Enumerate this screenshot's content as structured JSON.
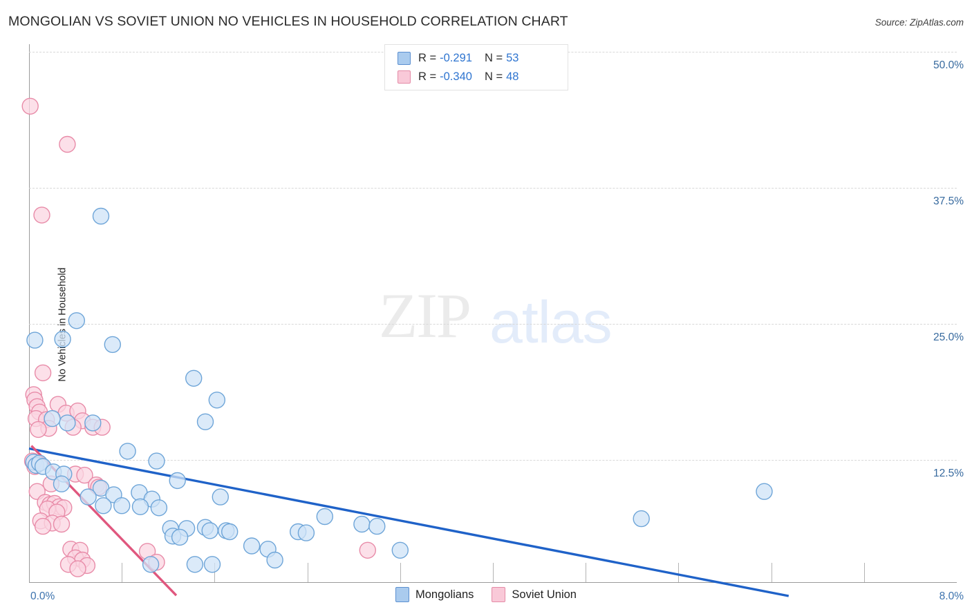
{
  "header": {
    "title": "MONGOLIAN VS SOVIET UNION NO VEHICLES IN HOUSEHOLD CORRELATION CHART",
    "source": "Source: ZipAtlas.com"
  },
  "watermark": {
    "part1": "ZIP",
    "part2": "atlas"
  },
  "stats": {
    "rows": [
      {
        "series": "Mongolians",
        "r_label": "R =",
        "r_value": "-0.291",
        "n_label": "N =",
        "n_value": "53",
        "color": "#aacbee"
      },
      {
        "series": "Soviet Union",
        "r_label": "R =",
        "r_value": "-0.340",
        "n_label": "N =",
        "n_value": "48",
        "color": "#f9c9d8"
      }
    ]
  },
  "legend": {
    "items": [
      {
        "label": "Mongolians",
        "color": "#aacbee"
      },
      {
        "label": "Soviet Union",
        "color": "#f9c9d8"
      }
    ]
  },
  "chart_data": {
    "type": "scatter",
    "title": "MONGOLIAN VS SOVIET UNION NO VEHICLES IN HOUSEHOLD CORRELATION CHART",
    "xlabel": "",
    "ylabel": "No Vehicles in Household",
    "xlim": [
      0.0,
      8.0
    ],
    "ylim": [
      0.0,
      53.0
    ],
    "grid": true,
    "legend_position": "bottom-center",
    "x_ticks": [
      {
        "value": 0.0,
        "label": "0.0%"
      },
      {
        "value": 8.0,
        "label": "8.0%"
      }
    ],
    "x_minor_ticks": [
      0.8,
      1.6,
      2.4,
      3.2,
      4.0,
      4.8,
      5.6,
      6.4,
      7.2
    ],
    "y_ticks": [
      {
        "value": 50.0,
        "label": "50.0%"
      },
      {
        "value": 37.5,
        "label": "37.5%"
      },
      {
        "value": 25.0,
        "label": "25.0%"
      },
      {
        "value": 12.5,
        "label": "12.5%"
      }
    ],
    "series": [
      {
        "name": "Mongolians",
        "color": "#cfe3f7",
        "edge": "#6ea5d8",
        "r": -0.291,
        "n": 53,
        "trendline": {
          "x0": 0.0,
          "y0": 13.55,
          "x1": 6.55,
          "y1": 0.0,
          "color": "#1f62c8"
        },
        "points": [
          {
            "x": 0.62,
            "y": 34.9
          },
          {
            "x": 0.41,
            "y": 25.3
          },
          {
            "x": 0.05,
            "y": 23.5
          },
          {
            "x": 0.29,
            "y": 23.6
          },
          {
            "x": 0.72,
            "y": 23.1
          },
          {
            "x": 1.42,
            "y": 20.0
          },
          {
            "x": 1.62,
            "y": 18.0
          },
          {
            "x": 1.52,
            "y": 16.0
          },
          {
            "x": 0.33,
            "y": 15.9
          },
          {
            "x": 0.2,
            "y": 16.3
          },
          {
            "x": 0.55,
            "y": 15.9
          },
          {
            "x": 0.85,
            "y": 13.3
          },
          {
            "x": 1.1,
            "y": 12.4
          },
          {
            "x": 0.04,
            "y": 12.3
          },
          {
            "x": 0.06,
            "y": 12.0
          },
          {
            "x": 0.09,
            "y": 12.2
          },
          {
            "x": 0.12,
            "y": 11.9
          },
          {
            "x": 0.21,
            "y": 11.4
          },
          {
            "x": 0.3,
            "y": 11.2
          },
          {
            "x": 1.28,
            "y": 10.6
          },
          {
            "x": 0.28,
            "y": 10.3
          },
          {
            "x": 0.62,
            "y": 9.9
          },
          {
            "x": 0.95,
            "y": 9.5
          },
          {
            "x": 0.73,
            "y": 9.3
          },
          {
            "x": 0.51,
            "y": 9.1
          },
          {
            "x": 1.06,
            "y": 8.9
          },
          {
            "x": 1.65,
            "y": 9.1
          },
          {
            "x": 0.64,
            "y": 8.3
          },
          {
            "x": 0.8,
            "y": 8.3
          },
          {
            "x": 0.96,
            "y": 8.2
          },
          {
            "x": 1.12,
            "y": 8.1
          },
          {
            "x": 2.55,
            "y": 7.3
          },
          {
            "x": 2.87,
            "y": 6.6
          },
          {
            "x": 3.0,
            "y": 6.4
          },
          {
            "x": 1.22,
            "y": 6.2
          },
          {
            "x": 1.36,
            "y": 6.2
          },
          {
            "x": 1.52,
            "y": 6.3
          },
          {
            "x": 1.24,
            "y": 5.5
          },
          {
            "x": 1.3,
            "y": 5.4
          },
          {
            "x": 1.56,
            "y": 6.0
          },
          {
            "x": 1.7,
            "y": 6.0
          },
          {
            "x": 1.73,
            "y": 5.9
          },
          {
            "x": 2.32,
            "y": 5.9
          },
          {
            "x": 2.39,
            "y": 5.8
          },
          {
            "x": 1.92,
            "y": 4.6
          },
          {
            "x": 2.06,
            "y": 4.3
          },
          {
            "x": 3.2,
            "y": 4.2
          },
          {
            "x": 2.12,
            "y": 3.3
          },
          {
            "x": 1.05,
            "y": 2.9
          },
          {
            "x": 1.43,
            "y": 2.9
          },
          {
            "x": 1.58,
            "y": 2.9
          },
          {
            "x": 5.28,
            "y": 7.1
          },
          {
            "x": 6.34,
            "y": 9.6
          }
        ]
      },
      {
        "name": "Soviet Union",
        "color": "#fbd6e2",
        "edge": "#e88ba8",
        "r": -0.34,
        "n": 48,
        "trendline": {
          "x0": 0.02,
          "y0": 13.8,
          "x1": 1.27,
          "y1": 0.05,
          "color": "#e0577e"
        },
        "points": [
          {
            "x": 0.01,
            "y": 45.0
          },
          {
            "x": 0.33,
            "y": 41.5
          },
          {
            "x": 0.11,
            "y": 35.0
          },
          {
            "x": 0.12,
            "y": 20.5
          },
          {
            "x": 0.04,
            "y": 18.5
          },
          {
            "x": 0.05,
            "y": 18.0
          },
          {
            "x": 0.07,
            "y": 17.4
          },
          {
            "x": 0.25,
            "y": 17.6
          },
          {
            "x": 0.09,
            "y": 16.9
          },
          {
            "x": 0.32,
            "y": 16.8
          },
          {
            "x": 0.42,
            "y": 17.0
          },
          {
            "x": 0.06,
            "y": 16.3
          },
          {
            "x": 0.15,
            "y": 16.2
          },
          {
            "x": 0.46,
            "y": 16.1
          },
          {
            "x": 0.38,
            "y": 15.5
          },
          {
            "x": 0.17,
            "y": 15.4
          },
          {
            "x": 0.08,
            "y": 15.3
          },
          {
            "x": 0.55,
            "y": 15.5
          },
          {
            "x": 0.63,
            "y": 15.5
          },
          {
            "x": 0.03,
            "y": 12.4
          },
          {
            "x": 0.05,
            "y": 11.9
          },
          {
            "x": 0.4,
            "y": 11.2
          },
          {
            "x": 0.48,
            "y": 11.1
          },
          {
            "x": 0.19,
            "y": 10.3
          },
          {
            "x": 0.58,
            "y": 10.2
          },
          {
            "x": 0.6,
            "y": 10.0
          },
          {
            "x": 0.07,
            "y": 9.6
          },
          {
            "x": 0.14,
            "y": 8.6
          },
          {
            "x": 0.18,
            "y": 8.4
          },
          {
            "x": 0.22,
            "y": 8.5
          },
          {
            "x": 0.26,
            "y": 8.2
          },
          {
            "x": 0.16,
            "y": 8.0
          },
          {
            "x": 0.3,
            "y": 8.1
          },
          {
            "x": 0.24,
            "y": 7.7
          },
          {
            "x": 0.1,
            "y": 6.9
          },
          {
            "x": 0.2,
            "y": 6.7
          },
          {
            "x": 0.28,
            "y": 6.6
          },
          {
            "x": 0.12,
            "y": 6.4
          },
          {
            "x": 0.36,
            "y": 4.3
          },
          {
            "x": 0.44,
            "y": 4.2
          },
          {
            "x": 0.4,
            "y": 3.5
          },
          {
            "x": 0.46,
            "y": 3.3
          },
          {
            "x": 0.34,
            "y": 2.9
          },
          {
            "x": 0.5,
            "y": 2.8
          },
          {
            "x": 0.42,
            "y": 2.5
          },
          {
            "x": 1.02,
            "y": 4.1
          },
          {
            "x": 1.1,
            "y": 3.1
          },
          {
            "x": 2.92,
            "y": 4.2
          }
        ]
      }
    ]
  },
  "axis": {
    "y_title": "No Vehicles in Household"
  }
}
